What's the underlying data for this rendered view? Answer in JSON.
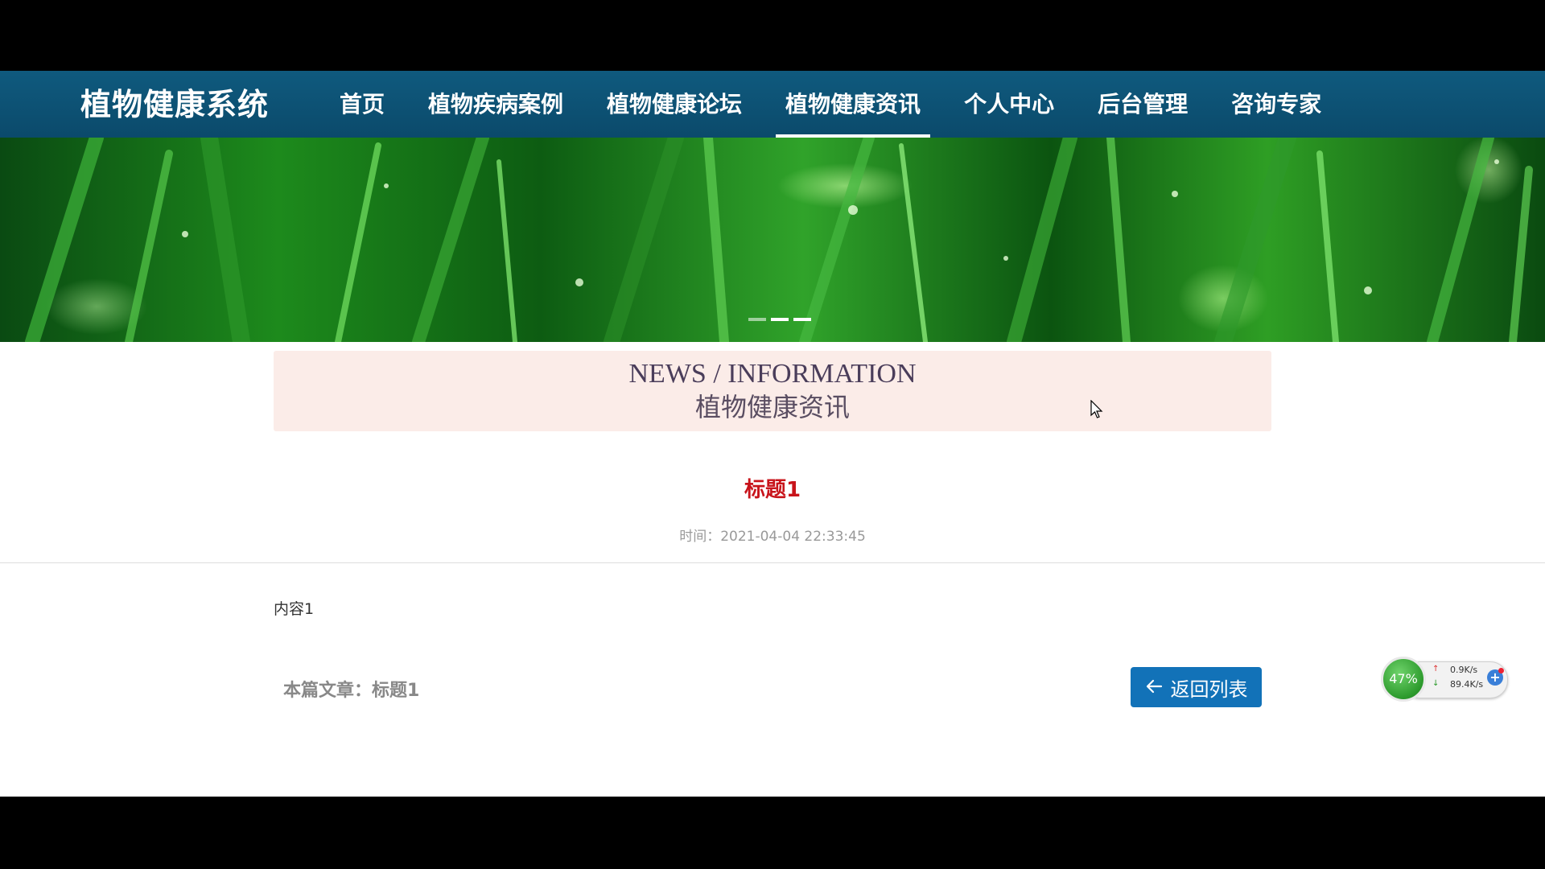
{
  "brand": "植物健康系统",
  "nav": {
    "items": [
      {
        "label": "首页"
      },
      {
        "label": "植物疾病案例"
      },
      {
        "label": "植物健康论坛"
      },
      {
        "label": "植物健康资讯"
      },
      {
        "label": "个人中心"
      },
      {
        "label": "后台管理"
      },
      {
        "label": "咨询专家"
      }
    ],
    "active": "植物健康资讯"
  },
  "section": {
    "english": "NEWS / INFORMATION",
    "chinese": "植物健康资讯"
  },
  "article": {
    "title": "标题1",
    "time": "时间：2021-04-04 22:33:45",
    "content": "内容1",
    "current": "本篇文章：标题1"
  },
  "back_button": {
    "label": "返回列表",
    "icon": "arrow-left-icon"
  },
  "banner": {
    "dots": 3,
    "active_dot": 2
  },
  "net_widget": {
    "cpu": "47%",
    "upload": "0.9K/s",
    "download": "89.4K/s"
  },
  "colors": {
    "nav_bg": "#0b4a6b",
    "title_red": "#c8141b",
    "button_blue": "#1272b8",
    "section_bg": "#fbece8"
  }
}
